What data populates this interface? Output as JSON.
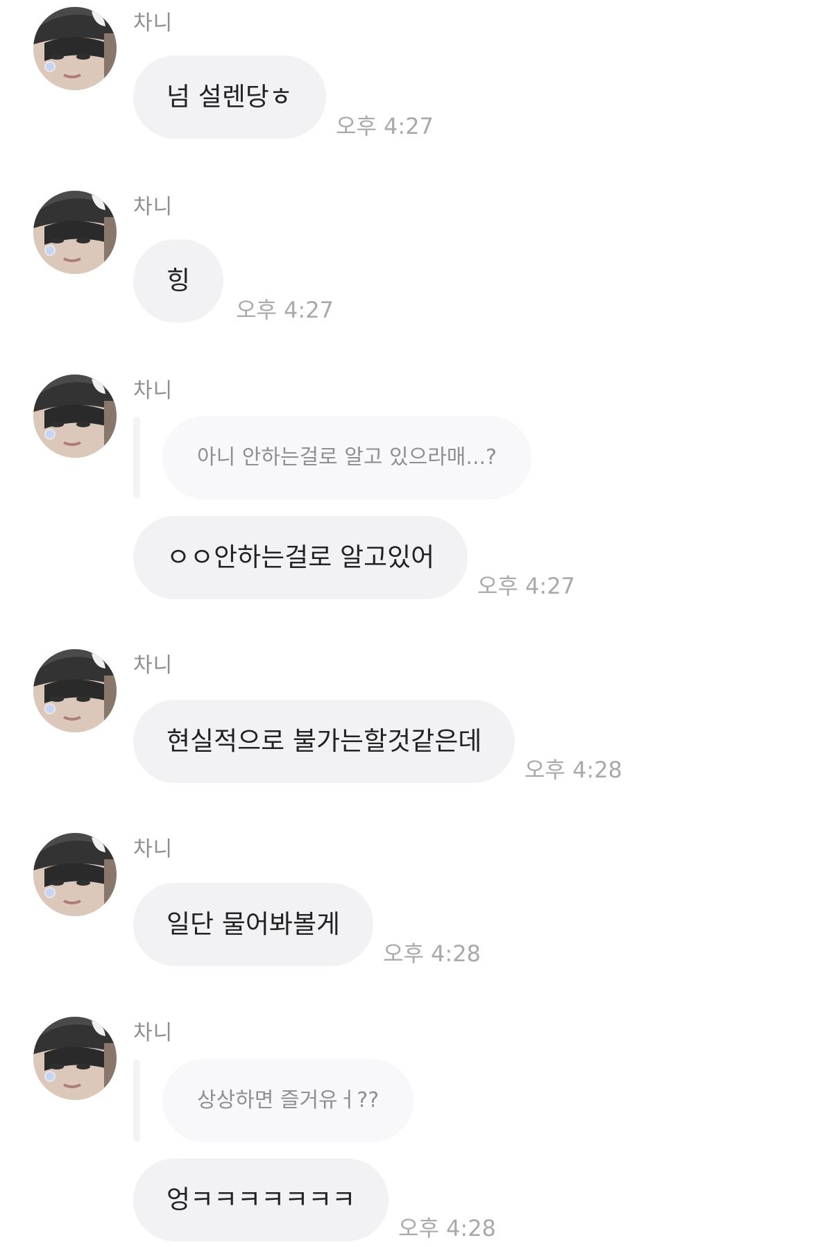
{
  "messages": [
    {
      "sender": "차니",
      "avatar_icon": "profile-avatar",
      "text": "넘 설렌당ㅎ",
      "time": "오후 4:27"
    },
    {
      "sender": "차니",
      "avatar_icon": "profile-avatar",
      "text": "힝",
      "time": "오후 4:27"
    },
    {
      "sender": "차니",
      "avatar_icon": "profile-avatar",
      "reply_to": "아니 안하는걸로 알고 있으라매...?",
      "text": "ㅇㅇ안하는걸로 알고있어",
      "time": "오후 4:27"
    },
    {
      "sender": "차니",
      "avatar_icon": "profile-avatar",
      "text": "현실적으로 불가는할것같은데",
      "time": "오후 4:28"
    },
    {
      "sender": "차니",
      "avatar_icon": "profile-avatar",
      "text": "일단 물어봐볼게",
      "time": "오후 4:28"
    },
    {
      "sender": "차니",
      "avatar_icon": "profile-avatar",
      "reply_to": "상상하면 즐거유ㅓ??",
      "text": "엉ㅋㅋㅋㅋㅋㅋㅋ",
      "time": "오후 4:28"
    }
  ],
  "colors": {
    "bubble": "#f2f2f4",
    "quote_bubble": "#f8f8fb",
    "sender_text": "#8e8e8e",
    "time_text": "#a8a8ad",
    "message_text": "#222222"
  }
}
